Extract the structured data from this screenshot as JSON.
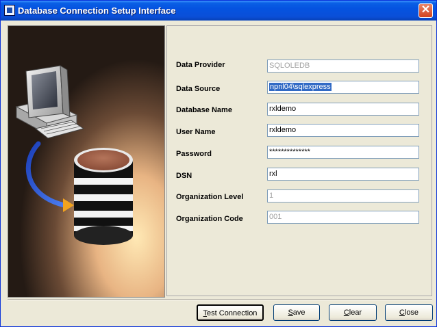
{
  "window": {
    "title": "Database Connection Setup Interface"
  },
  "form": {
    "fields": [
      {
        "label": "Data Provider",
        "value": "SQLOLEDB",
        "enabled": false
      },
      {
        "label": "Data Source",
        "value": "npril04\\sqlexpress",
        "enabled": true,
        "selected": true
      },
      {
        "label": "Database Name",
        "value": "rxldemo",
        "enabled": true
      },
      {
        "label": "User Name",
        "value": "rxldemo",
        "enabled": true
      },
      {
        "label": "Password",
        "value": "**************",
        "enabled": true
      },
      {
        "label": "DSN",
        "value": "rxl",
        "enabled": true
      },
      {
        "label": "Organization Level",
        "value": "1",
        "enabled": false
      },
      {
        "label": "Organization Code",
        "value": "001",
        "enabled": false
      }
    ]
  },
  "buttons": {
    "test_connection": {
      "first": "T",
      "rest": "est Connection"
    },
    "save": {
      "first": "S",
      "rest": "ave"
    },
    "clear": {
      "first": "C",
      "rest": "lear"
    },
    "close": {
      "first": "C",
      "rest": "lose"
    }
  },
  "icons": {
    "close": "close-icon",
    "app": "database-app-icon",
    "illustration": "computer-database-illustration"
  },
  "colors": {
    "titlebar": "#0553e0",
    "selection": "#316ac5",
    "window_bg": "#ece9d8"
  }
}
